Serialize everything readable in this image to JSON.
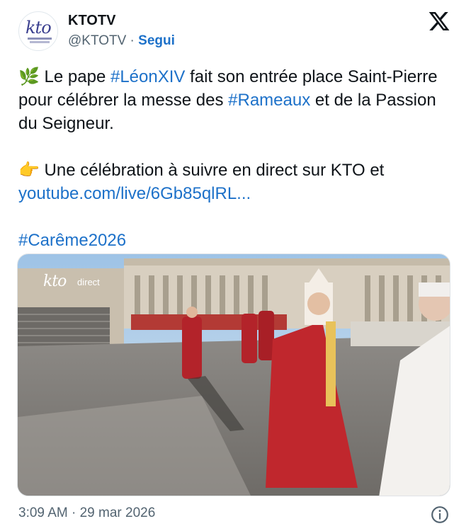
{
  "account": {
    "name": "KTOTV",
    "handle": "@KTOTV",
    "separator": " · ",
    "follow_label": "Segui",
    "avatar_logo": "kto"
  },
  "tweet": {
    "line1": {
      "emoji": "🌿",
      "t1": " Le pape ",
      "tag1": "#LéonXIV",
      "t2": " fait son entrée place Saint-Pierre pour célébrer la messe des ",
      "tag2": "#Rameaux",
      "t3": " et de la Passion du Seigneur."
    },
    "line2": {
      "emoji": "👉",
      "t1": " Une célébration à suivre en direct sur KTO et ",
      "link": "youtube.com/live/6Gb85qlRL..."
    },
    "line3": {
      "tag": "#Carême2026"
    }
  },
  "media": {
    "overlay_logo": "kto",
    "overlay_text": "direct"
  },
  "footer": {
    "timestamp": "3:09 AM · 29 mar 2026"
  },
  "icons": {
    "x_logo": "x-logo-icon",
    "info": "info-icon"
  }
}
